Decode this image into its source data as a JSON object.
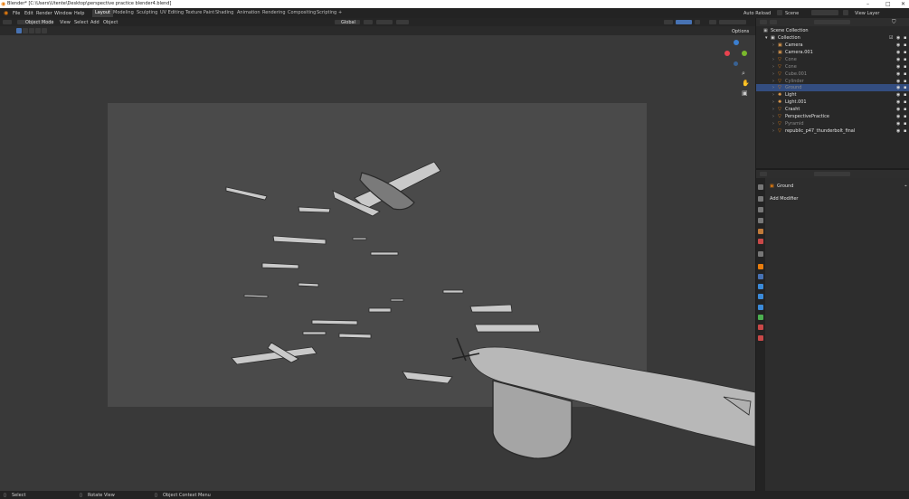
{
  "titlebar": {
    "title": "Blender* [C:\\Users\\Utente\\Desktop\\perspective practice blender4.blend]",
    "minimize": "–",
    "maximize": "□",
    "close": "✕"
  },
  "menu": [
    "File",
    "Edit",
    "Render",
    "Window",
    "Help"
  ],
  "workspaces": [
    "Layout",
    "Modeling",
    "Sculpting",
    "UV Editing",
    "Texture Paint",
    "Shading",
    "Animation",
    "Rendering",
    "Compositing",
    "Scripting"
  ],
  "workspace_add": "+",
  "topright": {
    "auto_reload": "Auto Reload",
    "scene": "Scene",
    "view_layer": "View Layer"
  },
  "viewport_header": {
    "mode": "Object Mode",
    "menus": [
      "View",
      "Select",
      "Add",
      "Object"
    ],
    "transform": "Global"
  },
  "options_label": "Options",
  "outliner": {
    "root": "Scene Collection",
    "collection": "Collection",
    "items": [
      {
        "name": "Camera",
        "color": "#e0e0e0",
        "icon": "camera-icon"
      },
      {
        "name": "Camera.001",
        "color": "#e0e0e0",
        "icon": "camera-icon"
      },
      {
        "name": "Cone",
        "color": "#8a8a8a",
        "icon": "mesh-icon"
      },
      {
        "name": "Cone",
        "color": "#8a8a8a",
        "icon": "mesh-icon"
      },
      {
        "name": "Cube.001",
        "color": "#8a8a8a",
        "icon": "mesh-icon"
      },
      {
        "name": "Cylinder",
        "color": "#8a8a8a",
        "icon": "mesh-icon"
      },
      {
        "name": "Ground",
        "color": "#8a8a8a",
        "icon": "mesh-icon"
      },
      {
        "name": "Light",
        "color": "#e0e0e0",
        "icon": "light-icon"
      },
      {
        "name": "Light.001",
        "color": "#e0e0e0",
        "icon": "light-icon"
      },
      {
        "name": "Crasht",
        "color": "#e0e0e0",
        "icon": "mesh-icon"
      },
      {
        "name": "PerspectivePractice",
        "color": "#e0e0e0",
        "icon": "mesh-icon"
      },
      {
        "name": "Pyramid",
        "color": "#8a8a8a",
        "icon": "mesh-icon"
      },
      {
        "name": "republic_p47_thunderbolt_final",
        "color": "#e0e0e0",
        "icon": "mesh-icon"
      }
    ]
  },
  "properties": {
    "object_name": "Ground",
    "add_modifier": "Add Modifier"
  },
  "statusbar": {
    "select": "Select",
    "rotate": "Rotate View",
    "context": "Object Context Menu"
  },
  "colors": {
    "accent": "#e87d0d",
    "selection": "#334d80",
    "x_axis": "#e8434f",
    "y_axis": "#7ab82c",
    "z_axis": "#3b7fd0"
  }
}
